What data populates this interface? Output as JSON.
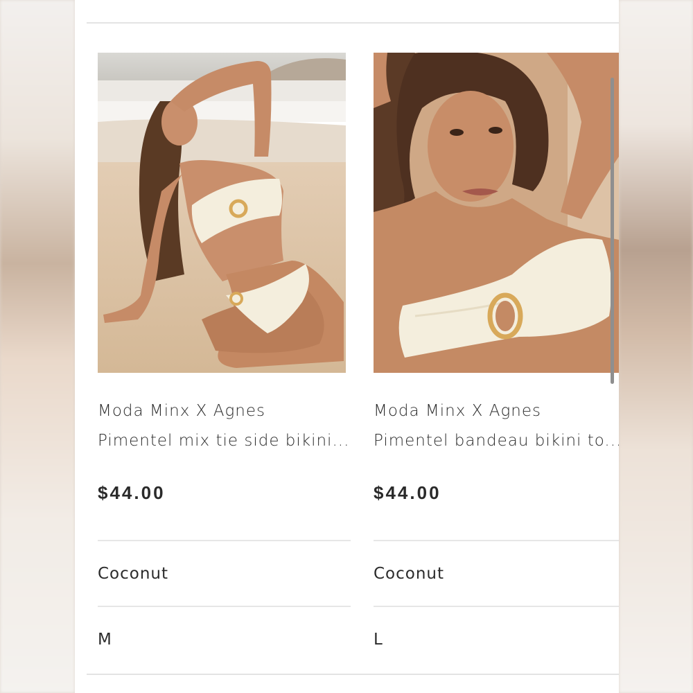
{
  "products": [
    {
      "title_line1": "Moda Minx X Agnes",
      "title_line2": "Pimentel mix tie side bikini...",
      "price": "$44.00",
      "color": "Coconut",
      "size": "M"
    },
    {
      "title_line1": "Moda Minx X Agnes",
      "title_line2": "Pimentel bandeau bikini to...",
      "price": "$44.00",
      "color": "Coconut",
      "size": "L"
    }
  ],
  "colors": {
    "panel": "#ffffff",
    "text": "#2b2b2b",
    "divider": "#e3e3e3",
    "swimwear": "#f4eedd",
    "sand": "#dcc3a8",
    "skin": "#c98f6c"
  }
}
